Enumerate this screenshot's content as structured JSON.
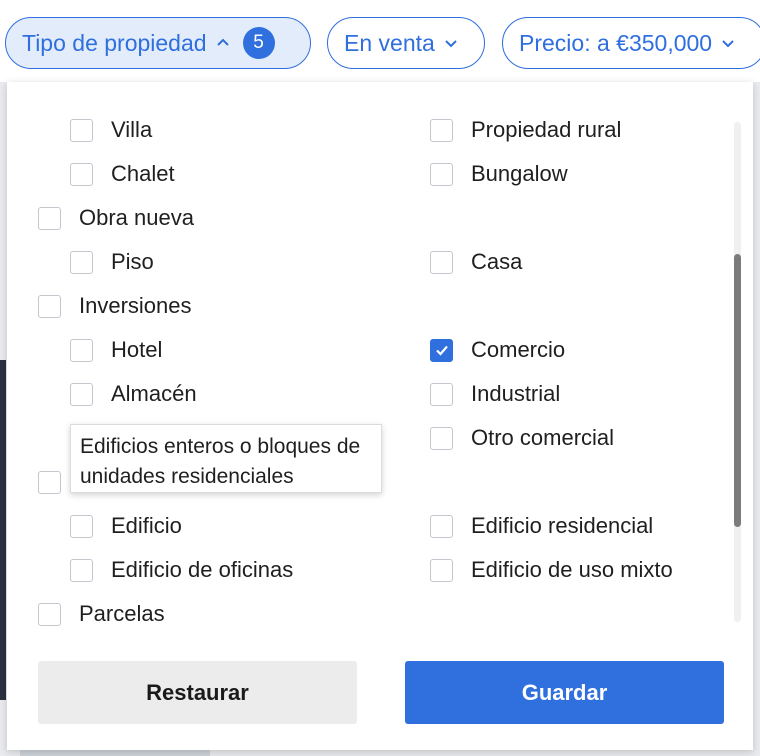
{
  "filters": {
    "property_type": {
      "label": "Tipo de propiedad",
      "count": "5"
    },
    "sale": {
      "label": "En venta"
    },
    "price": {
      "label": "Precio: a €350,000"
    }
  },
  "options": [
    {
      "label": "Villa",
      "checked": false
    },
    {
      "label": "Propiedad rural",
      "checked": false
    },
    {
      "label": "Chalet",
      "checked": false
    },
    {
      "label": "Bungalow",
      "checked": false
    },
    {
      "label": "Obra nueva",
      "checked": false
    },
    {
      "label": "Piso",
      "checked": false
    },
    {
      "label": "Casa",
      "checked": false
    },
    {
      "label": "Inversiones",
      "checked": false
    },
    {
      "label": "Hotel",
      "checked": false
    },
    {
      "label": "Comercio",
      "checked": true
    },
    {
      "label": "Almacén",
      "checked": false
    },
    {
      "label": "Industrial",
      "checked": false
    },
    {
      "label": "Otro comercial",
      "checked": false
    },
    {
      "label": "Edificio",
      "checked": false
    },
    {
      "label": "Edificio residencial",
      "checked": false
    },
    {
      "label": "Edificio de oficinas",
      "checked": false
    },
    {
      "label": "Edificio de uso mixto",
      "checked": false
    },
    {
      "label": "Parcelas",
      "checked": false
    }
  ],
  "tooltip": {
    "text": "Edificios enteros o bloques de unidades residenciales"
  },
  "buttons": {
    "reset": "Restaurar",
    "save": "Guardar"
  },
  "colors": {
    "accent": "#2f6fde",
    "reset_bg": "#ececec"
  }
}
